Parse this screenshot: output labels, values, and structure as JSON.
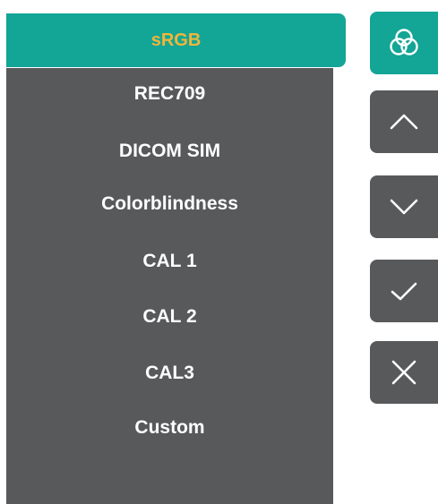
{
  "menu": {
    "items": [
      {
        "label": "sRGB",
        "selected": true
      },
      {
        "label": "REC709",
        "selected": false
      },
      {
        "label": "DICOM SIM",
        "selected": false
      },
      {
        "label": "Colorblindness",
        "selected": false
      },
      {
        "label": "CAL 1",
        "selected": false
      },
      {
        "label": "CAL 2",
        "selected": false
      },
      {
        "label": "CAL3",
        "selected": false
      },
      {
        "label": "Custom",
        "selected": false
      }
    ]
  },
  "controls": {
    "mode_icon": "color-circles-icon",
    "up_icon": "chevron-up-icon",
    "down_icon": "chevron-down-icon",
    "confirm_icon": "checkmark-icon",
    "cancel_icon": "close-icon"
  },
  "colors": {
    "accent": "#13a596",
    "panel": "#58595b",
    "selected_text": "#f0b63a",
    "text": "#ffffff"
  }
}
